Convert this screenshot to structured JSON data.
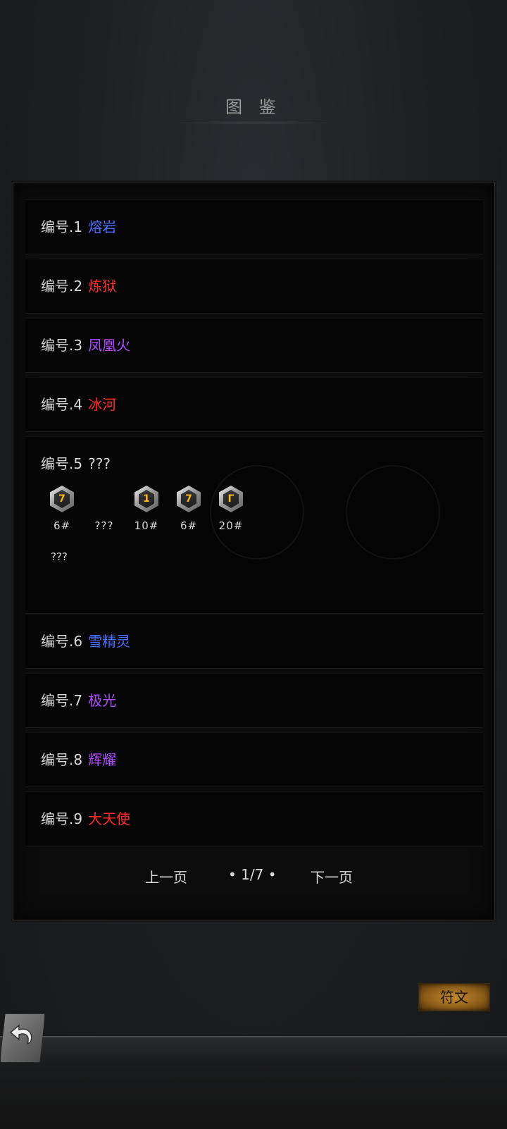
{
  "header": {
    "title": "图 鉴"
  },
  "entries": [
    {
      "number": "编号.1",
      "name": "熔岩",
      "color": "#4a6cff"
    },
    {
      "number": "编号.2",
      "name": "炼狱",
      "color": "#ff2b2b"
    },
    {
      "number": "编号.3",
      "name": "凤凰火",
      "color": "#b04bff"
    },
    {
      "number": "编号.4",
      "name": "冰河",
      "color": "#ff2b2b"
    },
    {
      "number": "编号.5",
      "name": "???",
      "color": "#d9d9d9",
      "gems": [
        {
          "glyph": "7",
          "label": "6#"
        },
        {
          "glyph": "",
          "label": "???"
        },
        {
          "glyph": "1",
          "label": "10#"
        },
        {
          "glyph": "7",
          "label": "6#"
        },
        {
          "glyph": "Γ",
          "label": "20#"
        }
      ],
      "extra_label": "???"
    },
    {
      "number": "编号.6",
      "name": "雪精灵",
      "color": "#4a6cff"
    },
    {
      "number": "编号.7",
      "name": "极光",
      "color": "#b04bff"
    },
    {
      "number": "编号.8",
      "name": "辉耀",
      "color": "#b04bff"
    },
    {
      "number": "编号.9",
      "name": "大天使",
      "color": "#ff2b2b"
    }
  ],
  "pager": {
    "prev": "上一页",
    "page": "• 1/7 •",
    "next": "下一页"
  },
  "rune_button": "符文"
}
